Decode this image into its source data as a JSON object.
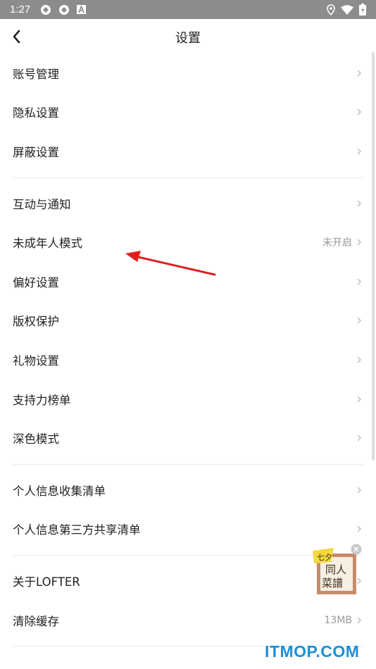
{
  "status_bar": {
    "time": "1:27"
  },
  "header": {
    "title": "设置"
  },
  "groups": [
    {
      "items": [
        {
          "label": "账号管理",
          "value": ""
        },
        {
          "label": "隐私设置",
          "value": ""
        },
        {
          "label": "屏蔽设置",
          "value": ""
        }
      ]
    },
    {
      "items": [
        {
          "label": "互动与通知",
          "value": ""
        },
        {
          "label": "未成年人模式",
          "value": "未开启"
        },
        {
          "label": "偏好设置",
          "value": ""
        },
        {
          "label": "版权保护",
          "value": ""
        },
        {
          "label": "礼物设置",
          "value": ""
        },
        {
          "label": "支持力榜单",
          "value": ""
        },
        {
          "label": "深色模式",
          "value": ""
        }
      ]
    },
    {
      "items": [
        {
          "label": "个人信息收集清单",
          "value": ""
        },
        {
          "label": "个人信息第三方共享清单",
          "value": ""
        }
      ]
    },
    {
      "items": [
        {
          "label": "关于LOFTER",
          "value": ""
        },
        {
          "label": "清除缓存",
          "value": "13MB"
        }
      ]
    }
  ],
  "floating_badge": {
    "text_line1": "同人",
    "text_line2": "菜譜",
    "corner": "七夕"
  },
  "watermark": "ITMOP.COM",
  "colors": {
    "statusbar": "#8c8c8c",
    "annotation_arrow": "#e02020",
    "watermark": "#1d8fd6"
  },
  "icons": [
    "wifi-icon",
    "battery-icon",
    "location-icon",
    "back-arrow-icon",
    "chevron-right-icon"
  ]
}
